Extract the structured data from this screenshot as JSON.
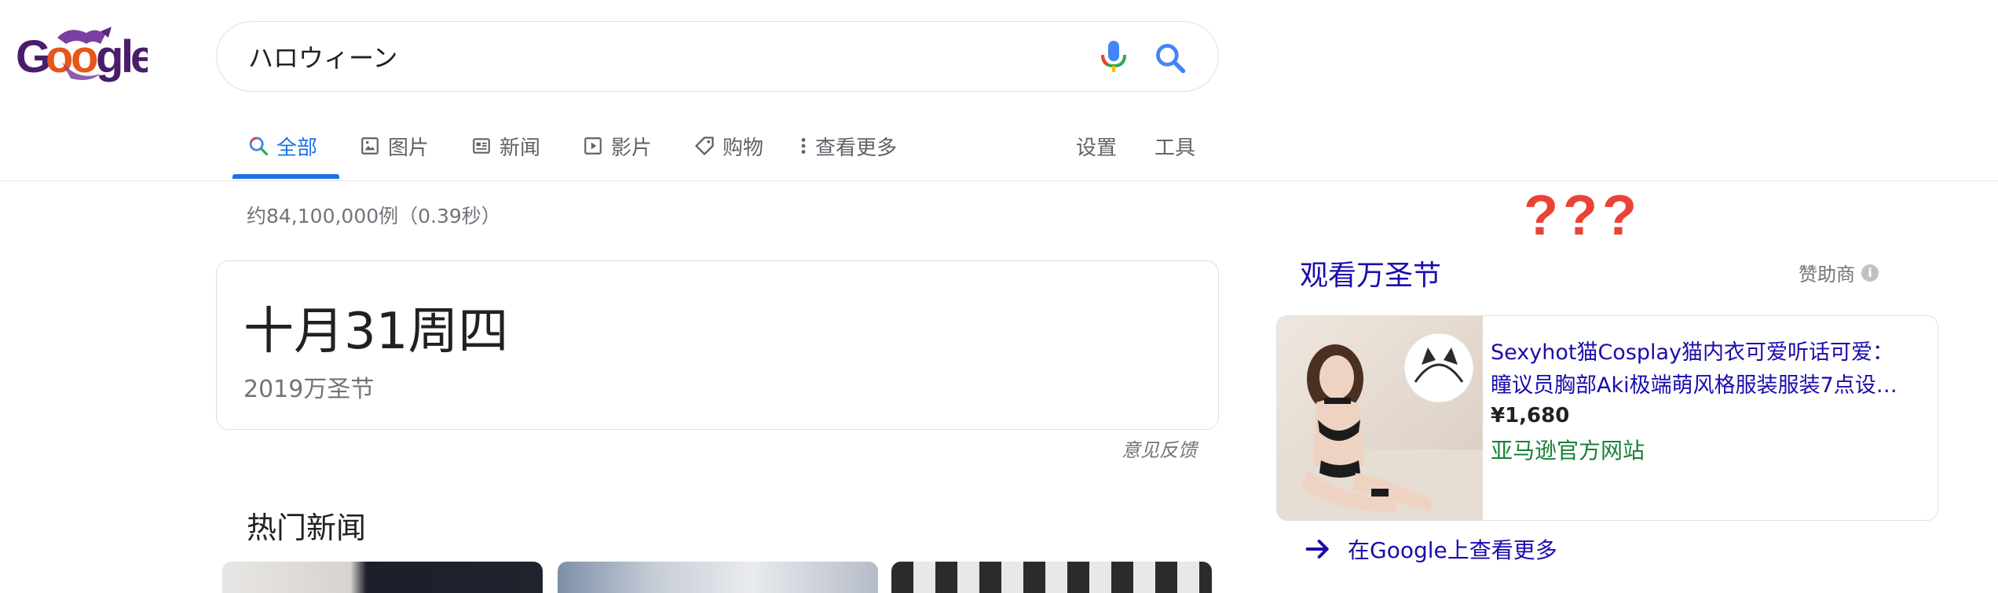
{
  "logo": {
    "letters": [
      "G",
      "o",
      "o",
      "g",
      "l",
      "e"
    ],
    "colors": [
      "#4a1d6b",
      "#e8561b",
      "#e8561b",
      "#4a1d6b",
      "#4a1d6b",
      "#4a1d6b"
    ]
  },
  "search": {
    "query": "ハロウィーン"
  },
  "tabs": [
    {
      "label": "全部",
      "icon": "search-icon"
    },
    {
      "label": "图片",
      "icon": "image-icon"
    },
    {
      "label": "新闻",
      "icon": "news-icon"
    },
    {
      "label": "影片",
      "icon": "video-icon"
    },
    {
      "label": "购物",
      "icon": "tag-icon"
    },
    {
      "label": "查看更多",
      "icon": "more-vert-icon"
    }
  ],
  "settings_label": "设置",
  "tools_label": "工具",
  "result_stats": "约84,100,000例（0.39秒）",
  "date_card": {
    "month": "十月",
    "day": "31",
    "weekday": "周四",
    "subtitle": "2019万圣节"
  },
  "feedback_label": "意见反馈",
  "news_heading": "热门新闻",
  "annotation": "???",
  "ads": {
    "title": "观看万圣节",
    "sponsor_label": "赞助商",
    "info_icon": "i",
    "product": {
      "title_line1": "Sexyhot猫Cosplay猫内衣可爱听话可爱：",
      "title_line2": "瞳议员胸部Aki极端萌风格服装服装7点设…",
      "price": "¥1,680",
      "store": "亚马逊官方网站"
    },
    "see_more": "在Google上查看更多"
  },
  "colors": {
    "accent": "#1a73e8",
    "link": "#1a0dab",
    "store": "#188038",
    "annotation": "#ea4335"
  }
}
